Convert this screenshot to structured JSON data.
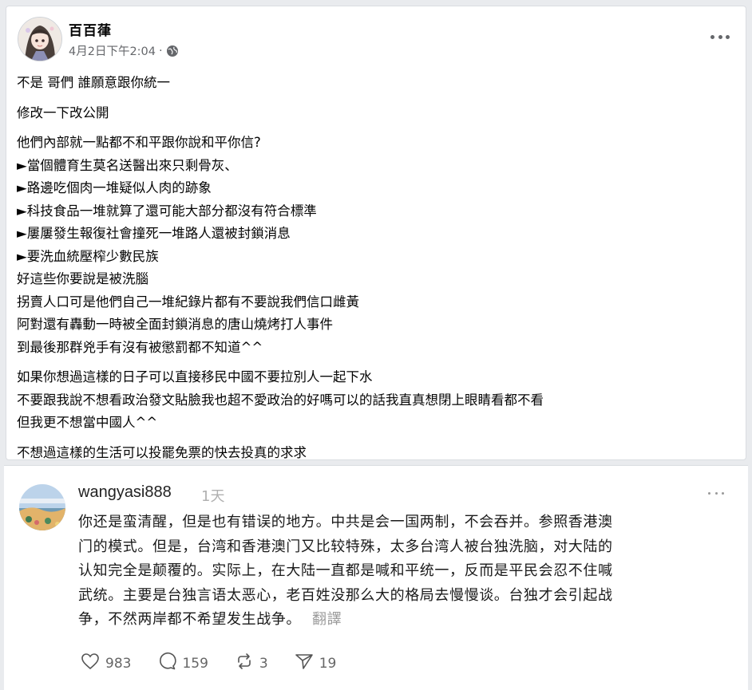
{
  "post": {
    "author": "百百葎",
    "timestamp": "4月2日下午2:04",
    "separator": "·",
    "privacy_icon": "globe-icon",
    "more_icon": "more-horizontal-icon",
    "paragraphs": [
      [
        "不是 哥們 誰願意跟你統一"
      ],
      [
        "修改一下改公開"
      ],
      [
        "他們內部就一點都不和平跟你說和平你信?",
        "►當個體育生莫名送醫出來只剩骨灰、",
        "►路邊吃個肉一堆疑似人肉的跡象",
        "►科技食品一堆就算了還可能大部分都沒有符合標準",
        "►屢屢發生報復社會撞死一堆路人還被封鎖消息",
        "►要洗血統壓榨少數民族",
        "好這些你要說是被洗腦",
        "拐賣人口可是他們自己一堆紀錄片都有不要說我們信口雌黃",
        "阿對還有轟動一時被全面封鎖消息的唐山燒烤打人事件",
        "到最後那群兇手有沒有被懲罰都不知道^^"
      ],
      [
        "如果你想過這樣的日子可以直接移民中國不要拉別人一起下水",
        "不要跟我說不想看政治發文貼臉我也超不愛政治的好嗎可以的話我直真想閉上眼睛看都不看",
        "但我更不想當中國人^^"
      ],
      [
        "不想過這樣的生活可以投罷免票的快去投真的求求"
      ]
    ]
  },
  "comment": {
    "username": "wangyasi888",
    "time": "1天",
    "more_icon": "more-horizontal-icon",
    "lines": [
      "你还是蛮清醒，但是也有错误的地方。中共是会一国两制，不会吞并。参照香港澳",
      "门的模式。但是，台湾和香港澳门又比较特殊，太多台湾人被台独洗脑，对大陆的",
      "认知完全是颠覆的。实际上，在大陆一直都是喊和平统一，反而是平民会忍不住喊",
      "武统。主要是台独言语太恶心，老百姓没那么大的格局去慢慢谈。台独才会引起战",
      "争，不然两岸都不希望发生战争。"
    ],
    "translate_label": "翻譯",
    "actions": {
      "likes": "983",
      "comments": "159",
      "reposts": "3",
      "shares": "19"
    }
  }
}
